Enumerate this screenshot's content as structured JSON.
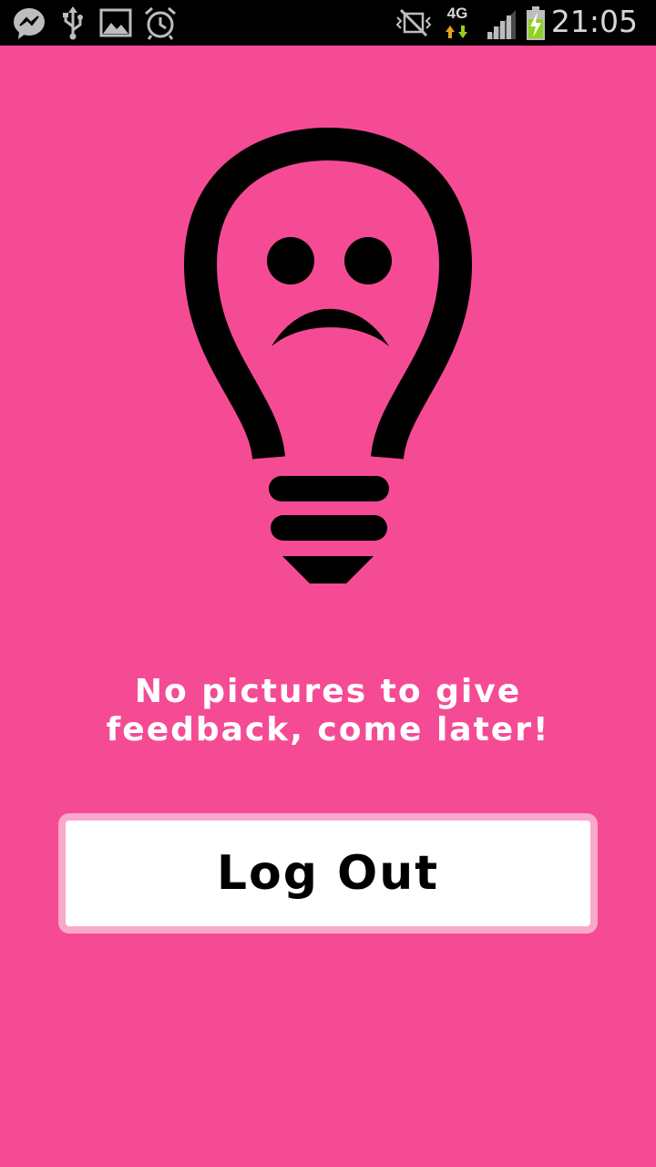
{
  "status_bar": {
    "time": "21:05",
    "network_label": "4G",
    "icons": [
      "messenger-icon",
      "usb-icon",
      "gallery-icon",
      "alarm-icon",
      "no-sound-icon",
      "4g-data-icon",
      "signal-icon",
      "battery-charging-icon"
    ]
  },
  "illustration": {
    "icon": "sad-lightbulb-icon",
    "color": "#000000"
  },
  "message": "No pictures to give feedback, come later!",
  "logout_button": {
    "label": "Log Out"
  },
  "colors": {
    "background": "#f54b94",
    "button_border": "#f9a7cb",
    "button_bg": "#ffffff"
  }
}
